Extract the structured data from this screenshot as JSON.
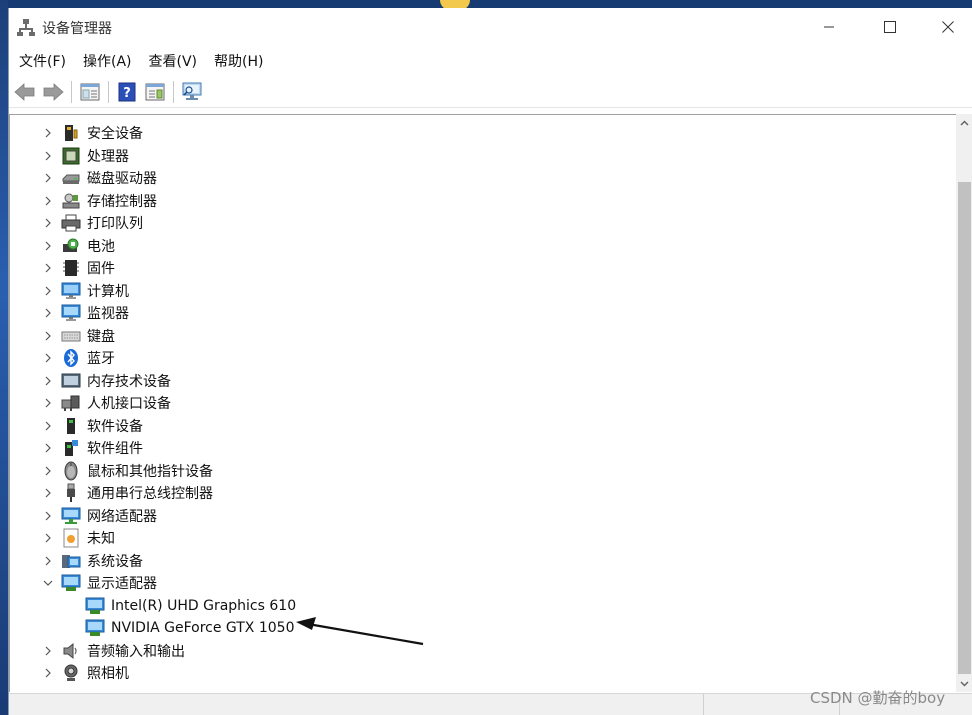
{
  "window": {
    "title": "设备管理器"
  },
  "menubar": {
    "items": [
      "文件(F)",
      "操作(A)",
      "查看(V)",
      "帮助(H)"
    ]
  },
  "toolbar": {
    "icons": [
      "back-arrow-icon",
      "forward-arrow-icon",
      "properties-icon",
      "help-icon",
      "update-driver-icon",
      "scan-hardware-icon"
    ]
  },
  "tree": {
    "nodes": [
      {
        "label": "安全设备",
        "icon": "security-device-icon",
        "expanded": false
      },
      {
        "label": "处理器",
        "icon": "processor-icon",
        "expanded": false
      },
      {
        "label": "磁盘驱动器",
        "icon": "disk-drive-icon",
        "expanded": false
      },
      {
        "label": "存储控制器",
        "icon": "storage-controller-icon",
        "expanded": false
      },
      {
        "label": "打印队列",
        "icon": "printer-icon",
        "expanded": false
      },
      {
        "label": "电池",
        "icon": "battery-icon",
        "expanded": false
      },
      {
        "label": "固件",
        "icon": "firmware-icon",
        "expanded": false
      },
      {
        "label": "计算机",
        "icon": "computer-icon",
        "expanded": false
      },
      {
        "label": "监视器",
        "icon": "monitor-icon",
        "expanded": false
      },
      {
        "label": "键盘",
        "icon": "keyboard-icon",
        "expanded": false
      },
      {
        "label": "蓝牙",
        "icon": "bluetooth-icon",
        "expanded": false
      },
      {
        "label": "内存技术设备",
        "icon": "memory-device-icon",
        "expanded": false
      },
      {
        "label": "人机接口设备",
        "icon": "hid-icon",
        "expanded": false
      },
      {
        "label": "软件设备",
        "icon": "software-device-icon",
        "expanded": false
      },
      {
        "label": "软件组件",
        "icon": "software-component-icon",
        "expanded": false
      },
      {
        "label": "鼠标和其他指针设备",
        "icon": "mouse-icon",
        "expanded": false
      },
      {
        "label": "通用串行总线控制器",
        "icon": "usb-icon",
        "expanded": false
      },
      {
        "label": "网络适配器",
        "icon": "network-adapter-icon",
        "expanded": false
      },
      {
        "label": "未知",
        "icon": "unknown-device-icon",
        "expanded": false
      },
      {
        "label": "系统设备",
        "icon": "system-device-icon",
        "expanded": false
      },
      {
        "label": "显示适配器",
        "icon": "display-adapter-icon",
        "expanded": true
      },
      {
        "label": "Intel(R) UHD Graphics 610",
        "icon": "display-adapter-icon",
        "child": true
      },
      {
        "label": "NVIDIA GeForce GTX 1050",
        "icon": "display-adapter-icon",
        "child": true
      },
      {
        "label": "音频输入和输出",
        "icon": "audio-icon",
        "expanded": false
      },
      {
        "label": "照相机",
        "icon": "camera-icon",
        "expanded": false
      }
    ]
  },
  "watermark": "CSDN @勤奋的boy",
  "colors": {
    "desktop": "#1d4a8c",
    "window_bg": "#ffffff",
    "scrollbar_thumb": "#c1c1c1"
  }
}
